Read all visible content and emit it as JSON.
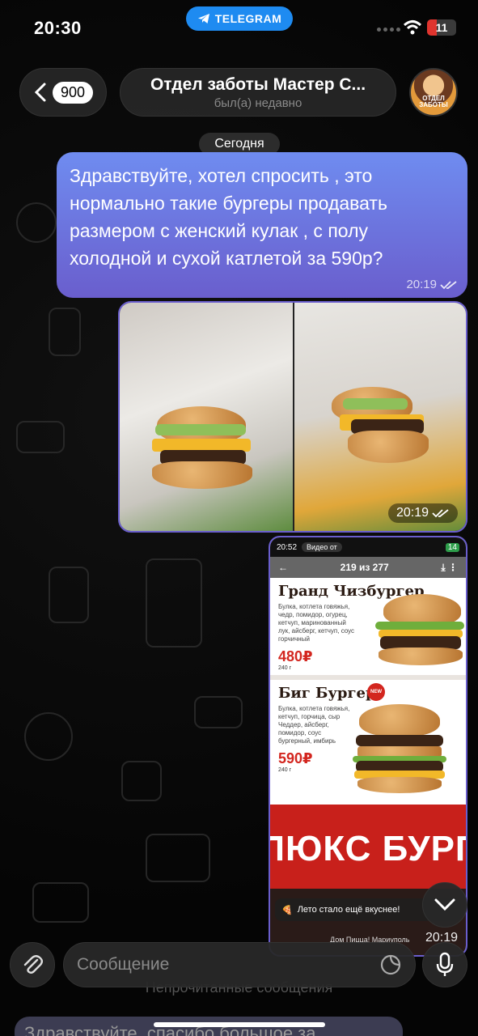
{
  "status_bar": {
    "time": "20:30",
    "app_pill": "TELEGRAM",
    "battery": "11"
  },
  "header": {
    "back_count": "900",
    "title": "Отдел заботы Мастер С...",
    "subtitle": "был(а) недавно",
    "avatar_label": "ОТДЕЛ ЗАБОТЫ"
  },
  "chat": {
    "date_chip": "Сегодня",
    "message_text": "Здравствуйте, хотел спросить , это нормально такие бургеры продавать размером с женский кулак , с полу холодной и сухой катлетой за 590р?",
    "message_time": "20:19",
    "photos_time": "20:19",
    "screenshot": {
      "status_time": "20:52",
      "status_pill": "Видео от",
      "status_battery": "14",
      "counter": "219 из 277",
      "item1_title": "Гранд Чизбургер",
      "item1_desc": "Булка, котлета говяжья, чедр, помидор, огурец, кетчуп, маринованный лук, айсберг, кетчуп, соус горчичный",
      "item1_price": "480₽",
      "item1_weight": "240 г",
      "item2_title": "Биг Бургер",
      "item2_badge": "NEW",
      "item2_desc": "Булка, котлета говяжья, кетчуп, горчица, сыр Чеддер, айсберг, помидор, соус бургерный, имбирь",
      "item2_price": "590₽",
      "item2_weight": "240 г",
      "banner": "ЛЮКС БУРГ",
      "promo": "Лето стало ещё вкуснее!",
      "promo_footer": "Дом Пицца! Мариуполь",
      "time": "20:19"
    }
  },
  "input": {
    "placeholder": "Сообщение",
    "ghost_unread": "Непрочитанные сообщения",
    "ghost_message": "Здравствуйте, спасибо большое за"
  },
  "colors": {
    "bubble_top": "#6f8cf0",
    "bubble_bottom": "#6a5ecd",
    "telegram_blue": "#1e8bf1",
    "battery_red": "#e0342e"
  }
}
